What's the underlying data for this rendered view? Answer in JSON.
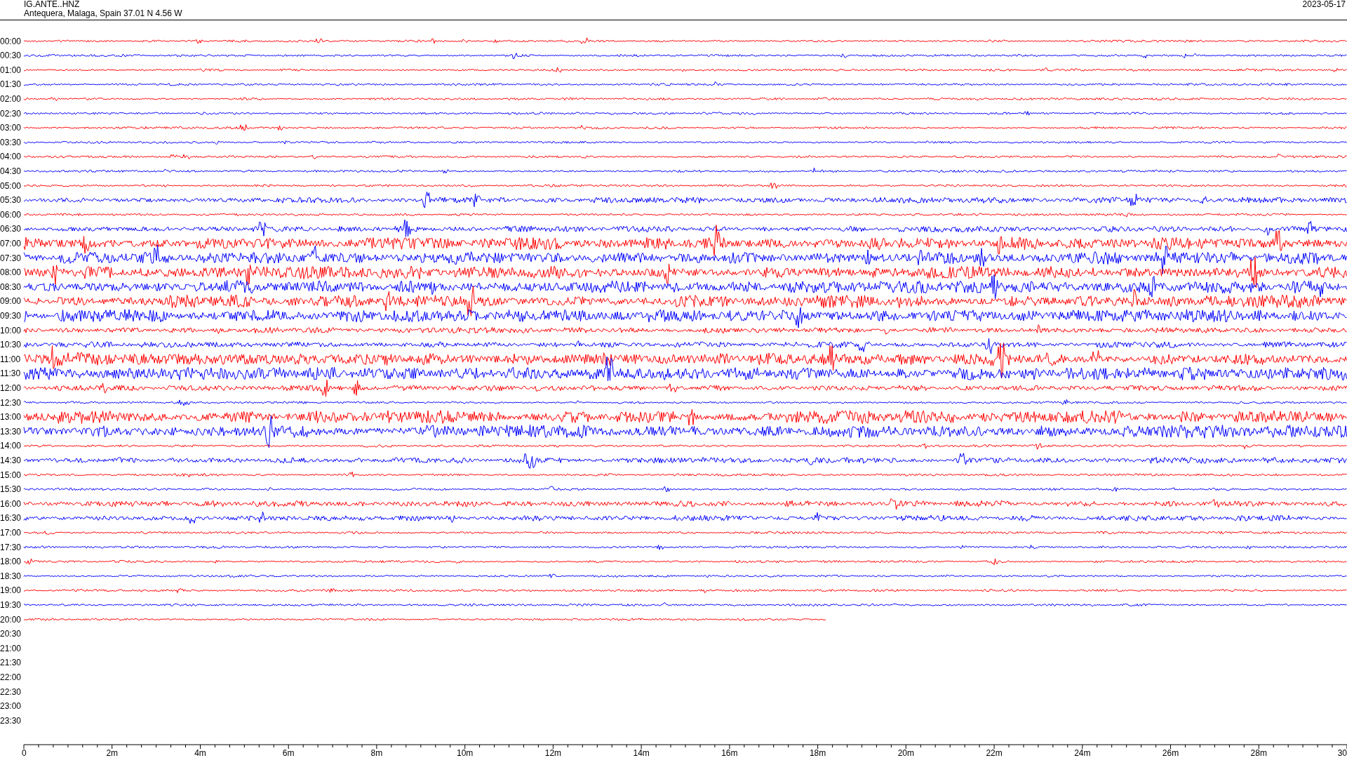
{
  "header": {
    "station": "IG.ANTE..HNZ",
    "location": "Antequera, Malaga, Spain  37.01 N 4.56 W",
    "date": "2023-05-17"
  },
  "rows": [
    {
      "time": "00:00",
      "color": "#ff0000",
      "kind": "quiet"
    },
    {
      "time": "00:30",
      "color": "#0000ff",
      "kind": "quiet"
    },
    {
      "time": "01:00",
      "color": "#ff0000",
      "kind": "quiet"
    },
    {
      "time": "01:30",
      "color": "#0000ff",
      "kind": "quiet"
    },
    {
      "time": "02:00",
      "color": "#ff0000",
      "kind": "quiet"
    },
    {
      "time": "02:30",
      "color": "#0000ff",
      "kind": "quiet"
    },
    {
      "time": "03:00",
      "color": "#ff0000",
      "kind": "quiet"
    },
    {
      "time": "03:30",
      "color": "#0000ff",
      "kind": "quiet"
    },
    {
      "time": "04:00",
      "color": "#ff0000",
      "kind": "quiet"
    },
    {
      "time": "04:30",
      "color": "#0000ff",
      "kind": "quiet"
    },
    {
      "time": "05:00",
      "color": "#ff0000",
      "kind": "quiet"
    },
    {
      "time": "05:30",
      "color": "#0000ff",
      "kind": "moderate"
    },
    {
      "time": "06:00",
      "color": "#ff0000",
      "kind": "quiet"
    },
    {
      "time": "06:30",
      "color": "#0000ff",
      "kind": "moderate"
    },
    {
      "time": "07:00",
      "color": "#ff0000",
      "kind": "busy"
    },
    {
      "time": "07:30",
      "color": "#0000ff",
      "kind": "busy"
    },
    {
      "time": "08:00",
      "color": "#ff0000",
      "kind": "busy"
    },
    {
      "time": "08:30",
      "color": "#0000ff",
      "kind": "busy"
    },
    {
      "time": "09:00",
      "color": "#ff0000",
      "kind": "busy"
    },
    {
      "time": "09:30",
      "color": "#0000ff",
      "kind": "busy"
    },
    {
      "time": "10:00",
      "color": "#ff0000",
      "kind": "moderate"
    },
    {
      "time": "10:30",
      "color": "#0000ff",
      "kind": "moderate"
    },
    {
      "time": "11:00",
      "color": "#ff0000",
      "kind": "busy"
    },
    {
      "time": "11:30",
      "color": "#0000ff",
      "kind": "busy"
    },
    {
      "time": "12:00",
      "color": "#ff0000",
      "kind": "moderate"
    },
    {
      "time": "12:30",
      "color": "#0000ff",
      "kind": "quiet"
    },
    {
      "time": "13:00",
      "color": "#ff0000",
      "kind": "busy"
    },
    {
      "time": "13:30",
      "color": "#0000ff",
      "kind": "busy"
    },
    {
      "time": "14:00",
      "color": "#ff0000",
      "kind": "quiet"
    },
    {
      "time": "14:30",
      "color": "#0000ff",
      "kind": "moderate"
    },
    {
      "time": "15:00",
      "color": "#ff0000",
      "kind": "quiet"
    },
    {
      "time": "15:30",
      "color": "#0000ff",
      "kind": "quiet"
    },
    {
      "time": "16:00",
      "color": "#ff0000",
      "kind": "moderate"
    },
    {
      "time": "16:30",
      "color": "#0000ff",
      "kind": "moderate"
    },
    {
      "time": "17:00",
      "color": "#ff0000",
      "kind": "quiet"
    },
    {
      "time": "17:30",
      "color": "#0000ff",
      "kind": "quiet"
    },
    {
      "time": "18:00",
      "color": "#ff0000",
      "kind": "quiet"
    },
    {
      "time": "18:30",
      "color": "#0000ff",
      "kind": "quiet"
    },
    {
      "time": "19:00",
      "color": "#ff0000",
      "kind": "quiet"
    },
    {
      "time": "19:30",
      "color": "#0000ff",
      "kind": "quiet"
    },
    {
      "time": "20:00",
      "color": "#ff0000",
      "kind": "partial"
    },
    {
      "time": "20:30",
      "kind": "none"
    },
    {
      "time": "21:00",
      "kind": "none"
    },
    {
      "time": "21:30",
      "kind": "none"
    },
    {
      "time": "22:00",
      "kind": "none"
    },
    {
      "time": "22:30",
      "kind": "none"
    },
    {
      "time": "23:00",
      "kind": "none"
    },
    {
      "time": "23:30",
      "kind": "none"
    }
  ],
  "axis_ticks": [
    "0",
    "2m",
    "4m",
    "6m",
    "8m",
    "10m",
    "12m",
    "14m",
    "16m",
    "18m",
    "20m",
    "22m",
    "24m",
    "26m",
    "28m",
    "30"
  ]
}
